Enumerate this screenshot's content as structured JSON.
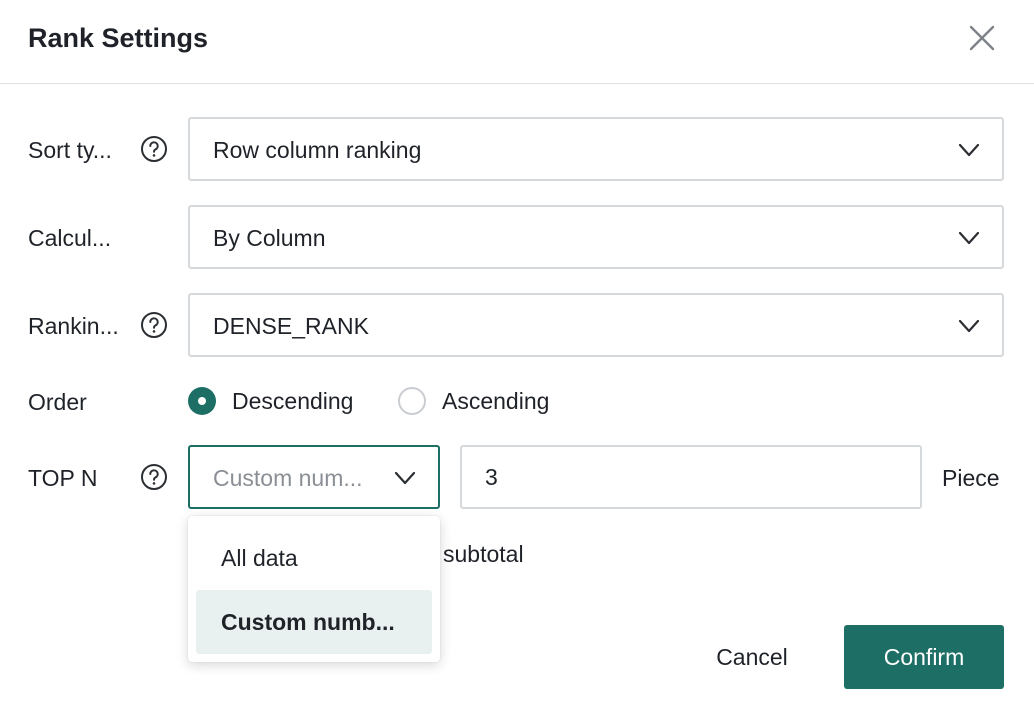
{
  "dialog": {
    "title": "Rank Settings",
    "close_icon": "close-icon"
  },
  "fields": {
    "sort_type": {
      "label": "Sort ty...",
      "value": "Row column ranking",
      "has_help": true
    },
    "calculation": {
      "label": "Calcul...",
      "value": "By Column",
      "has_help": false
    },
    "ranking": {
      "label": "Rankin...",
      "value": "DENSE_RANK",
      "has_help": true
    },
    "order": {
      "label": "Order",
      "options": [
        {
          "label": "Descending",
          "checked": true
        },
        {
          "label": "Ascending",
          "checked": false
        }
      ]
    },
    "top_n": {
      "label": "TOP N",
      "has_help": true,
      "mode_placeholder": "Custom num...",
      "count_value": "3",
      "unit": "Piece"
    },
    "subtotal_text": "subtotal"
  },
  "dropdown": {
    "options": [
      {
        "label": "All data",
        "selected": false
      },
      {
        "label": "Custom numb...",
        "selected": true
      }
    ]
  },
  "footer": {
    "cancel_label": "Cancel",
    "confirm_label": "Confirm"
  },
  "colors": {
    "accent": "#1d6f66",
    "selected_option_bg": "#e9f1f0",
    "border": "#d6d9dc"
  }
}
